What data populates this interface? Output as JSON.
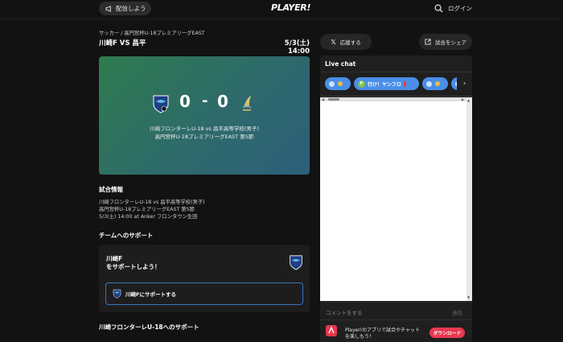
{
  "header": {
    "broadcast_label": "配信しよう",
    "logo": "PLAYER!",
    "login_label": "ログイン",
    "search_icon": "search-icon"
  },
  "match": {
    "breadcrumb": "サッカー / 高円宮杯U-18プレミアリーグEAST",
    "title": "川崎F VS 昌平",
    "date": "5/3(土) 14:00",
    "home_score": "0",
    "separator": "-",
    "away_score": "0",
    "card_line1": "川崎フロンターレU-18 vs 昌平高等学校(男子)",
    "card_line2": "高円宮杯U-18プレミアリーグEAST 第5節",
    "colors": {
      "card_start": "#2f7b4f",
      "card_end": "#2d5f7a"
    }
  },
  "info": {
    "heading": "試合情報",
    "lines": [
      "川崎フロンターレU-18 vs 昌平高等学校(男子)",
      "高円宮杯U-18プレミアリーグEAST 第5節",
      "5/3(土) 14:00 at Anker フロンタウン生田"
    ]
  },
  "support": {
    "heading": "チームへのサポート",
    "team": "川崎F",
    "cta": "をサポートしよう！",
    "button_label": "川崎Fにサポートする",
    "next_heading": "川崎フロンターレU-18へのサポート",
    "accent": "#3d74c4"
  },
  "actions": {
    "cheer_label": "応援する",
    "share_label": "試合をシェア"
  },
  "chat": {
    "title": "Live chat",
    "chips": [
      {
        "label": ""
      },
      {
        "label": "行け！ヤンフロ"
      },
      {
        "label": ""
      }
    ],
    "comment_placeholder": "コメントをする",
    "send_label": "送信",
    "app_line1": "Player!のアプリで試合やチャット",
    "app_line2": "を楽しもう！",
    "download_label": "ダウンロード",
    "chip_color": "#4a8ee8",
    "download_color": "#e8384f"
  }
}
